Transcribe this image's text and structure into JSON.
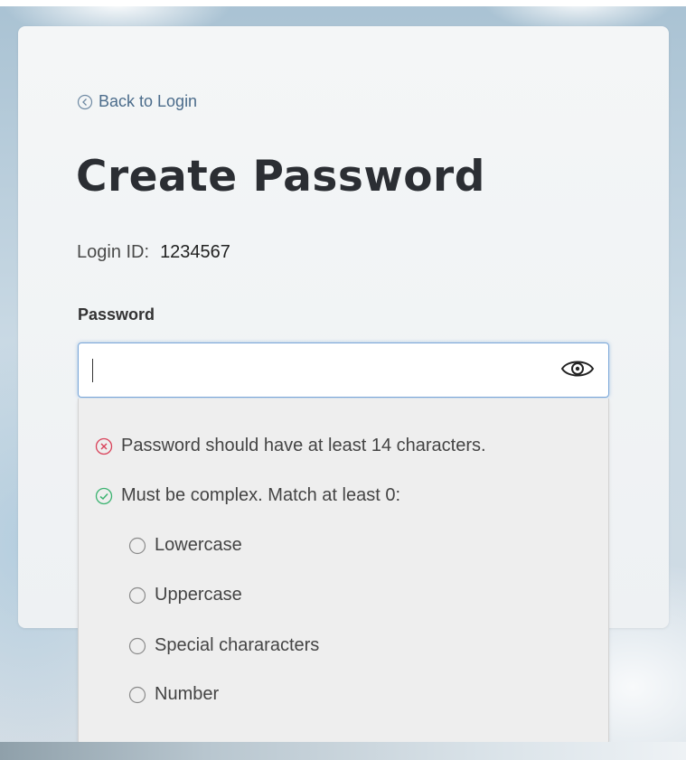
{
  "back_link": {
    "label": "Back to Login",
    "icon": "chevron-left-circle-icon"
  },
  "page": {
    "title": "Create Password"
  },
  "login": {
    "label": "Login ID:",
    "value": "1234567"
  },
  "password_field": {
    "label": "Password",
    "value": "",
    "toggle_icon": "eye-icon"
  },
  "rules": {
    "items": [
      {
        "text": "Password should have at least 14 characters.",
        "status": "failed",
        "icon": "x-circle-icon",
        "color": "#d9425a"
      },
      {
        "text": "Must be complex. Match at least 0:",
        "status": "passed",
        "icon": "check-circle-icon",
        "color": "#3cb371"
      }
    ],
    "sub_items": [
      {
        "text": "Lowercase",
        "status": "unmet",
        "icon": "empty-circle-icon"
      },
      {
        "text": "Uppercase",
        "status": "unmet",
        "icon": "empty-circle-icon"
      },
      {
        "text": "Special chararacters",
        "status": "unmet",
        "icon": "empty-circle-icon"
      },
      {
        "text": "Number",
        "status": "unmet",
        "icon": "empty-circle-icon"
      }
    ]
  },
  "colors": {
    "link": "#4b6c8b",
    "title": "#2b2e33",
    "focus_border": "#7aa7d9",
    "error": "#d9425a",
    "success": "#3cb371",
    "neutral_icon": "#8a8a8a"
  }
}
